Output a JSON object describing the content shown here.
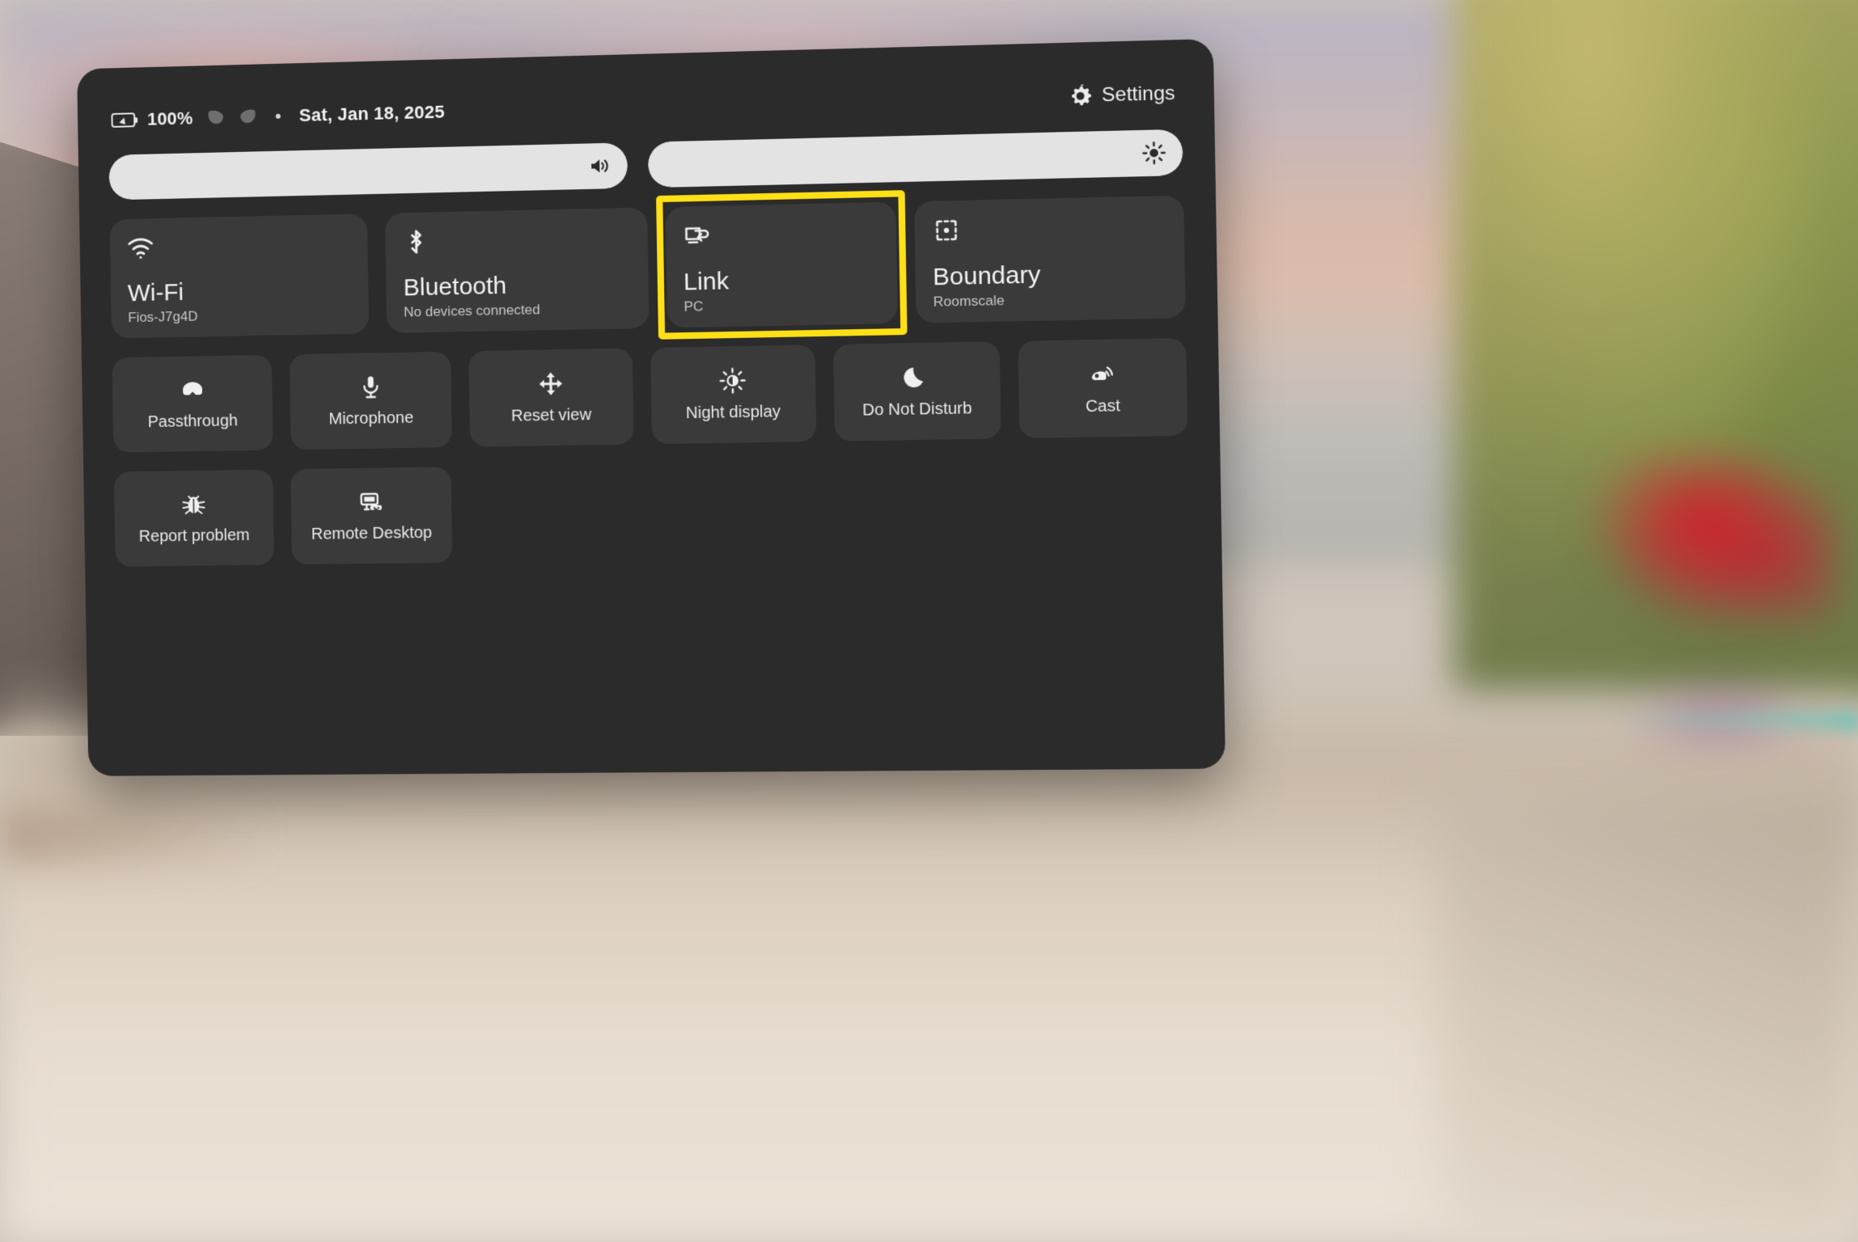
{
  "status_bar": {
    "battery_icon": "battery-charging-icon",
    "battery_percent": "100%",
    "left_controller_icon": "left-controller-icon",
    "right_controller_icon": "right-controller-icon",
    "separator": "•",
    "date": "Sat, Jan 18, 2025",
    "settings_icon": "gear-icon",
    "settings_label": "Settings"
  },
  "sliders": [
    {
      "name": "volume",
      "icon": "volume-up-icon",
      "value": 100
    },
    {
      "name": "brightness",
      "icon": "brightness-sun-icon",
      "value": 100
    }
  ],
  "tiles": [
    {
      "icon": "wifi-icon",
      "title": "Wi-Fi",
      "subtitle": "Fios-J7g4D",
      "highlighted": false
    },
    {
      "icon": "bluetooth-icon",
      "title": "Bluetooth",
      "subtitle": "No devices connected",
      "highlighted": false
    },
    {
      "icon": "link-cast-icon",
      "title": "Link",
      "subtitle": "PC",
      "highlighted": true
    },
    {
      "icon": "boundary-icon",
      "title": "Boundary",
      "subtitle": "Roomscale",
      "highlighted": false
    }
  ],
  "actions_row_1": [
    {
      "icon": "headset-icon",
      "label": "Passthrough"
    },
    {
      "icon": "microphone-icon",
      "label": "Microphone"
    },
    {
      "icon": "move-arrows-icon",
      "label": "Reset view"
    },
    {
      "icon": "brightness-sun-icon",
      "label": "Night display"
    },
    {
      "icon": "moon-icon",
      "label": "Do Not Disturb"
    },
    {
      "icon": "cast-icon",
      "label": "Cast"
    }
  ],
  "actions_row_2": [
    {
      "icon": "bug-icon",
      "label": "Report problem"
    },
    {
      "icon": "remote-desktop-icon",
      "label": "Remote Desktop"
    }
  ],
  "colors": {
    "panel_background": "#2b2b2b",
    "tile_background": "#3a3a3a",
    "slider_fill": "#e3e3e3",
    "highlight_outline": "#ffe016",
    "primary_text": "#f2f2f2",
    "secondary_text": "#c6c6c6"
  }
}
